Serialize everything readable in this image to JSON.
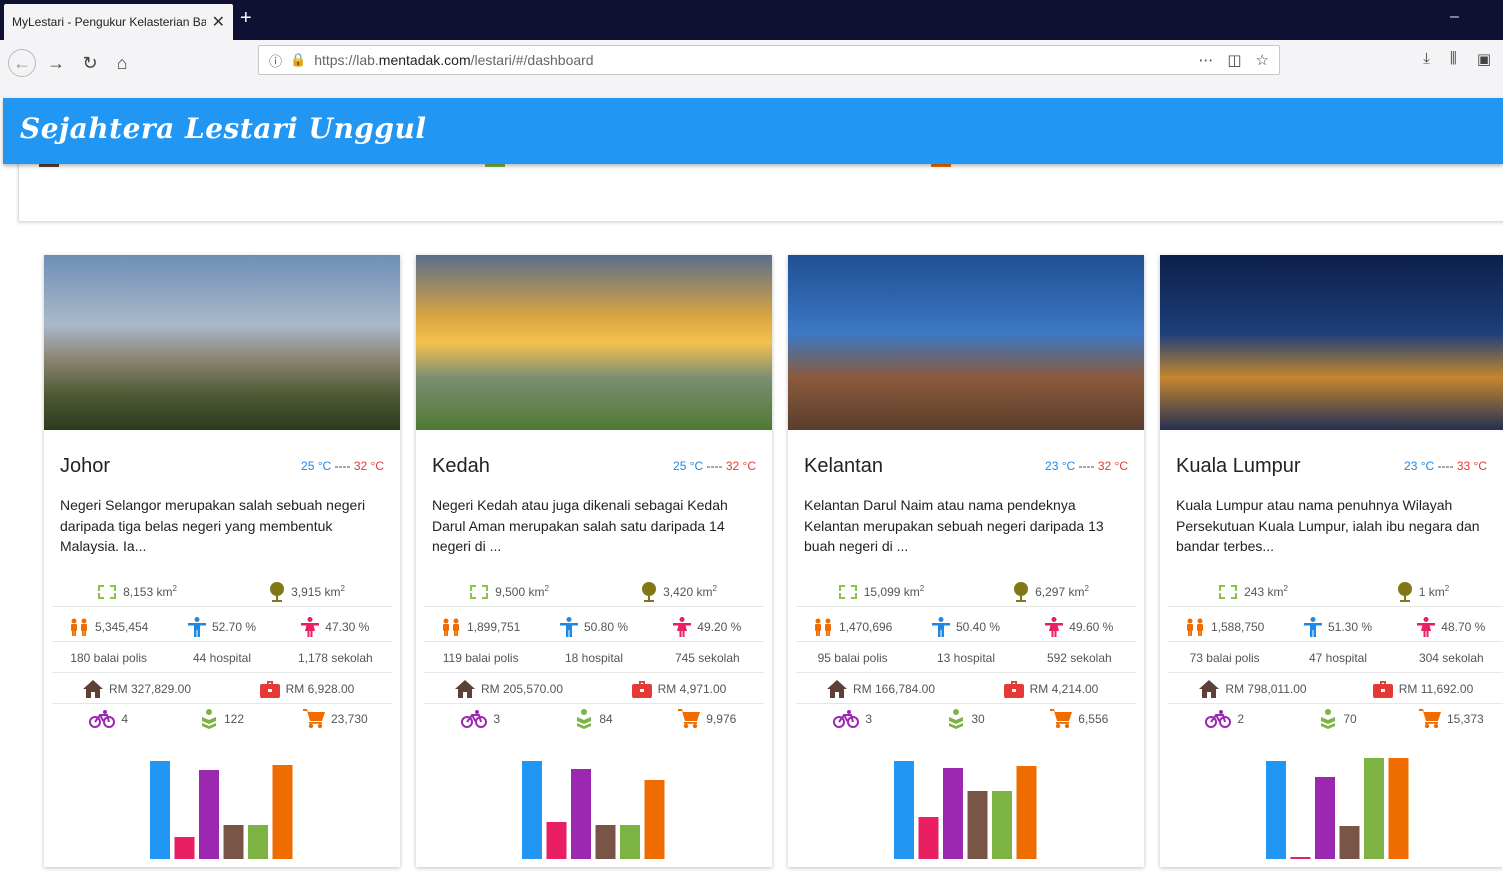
{
  "browser": {
    "tab_title": "MyLestari - Pengukur Kelasterian Ba",
    "url_prefix": "https://lab.",
    "url_domain": "mentadak.com",
    "url_path": "/lestari/#/dashboard"
  },
  "app": {
    "title": "Sejahtera Lestari Unggul"
  },
  "colors": {
    "header": "#2196f3",
    "bar_colors": [
      "#2196f3",
      "#e91e63",
      "#9c27b0",
      "#795548",
      "#7cb342",
      "#ef6c00"
    ]
  },
  "states": [
    {
      "name": "Johor",
      "temp_min": "25 °C",
      "temp_sep": "----",
      "temp_max": "32 °C",
      "desc": "Negeri Selangor merupakan salah sebuah negeri daripada tiga belas negeri yang membentuk Malaysia. Ia...",
      "area": "8,153 km",
      "forest": "3,915 km",
      "population": "5,345,454",
      "male": "52.70 %",
      "female": "47.30 %",
      "police": "180 balai polis",
      "hospital": "44 hospital",
      "school": "1,178 sekolah",
      "house": "RM 327,829.00",
      "income": "RM 6,928.00",
      "bike": "4",
      "park": "122",
      "shop": "23,730",
      "bars": [
        98,
        22,
        89,
        34,
        34,
        94
      ]
    },
    {
      "name": "Kedah",
      "temp_min": "25 °C",
      "temp_sep": "----",
      "temp_max": "32 °C",
      "desc": "Negeri Kedah atau juga dikenali sebagai Kedah Darul Aman merupakan salah satu daripada 14 negeri di ...",
      "area": "9,500 km",
      "forest": "3,420 km",
      "population": "1,899,751",
      "male": "50.80 %",
      "female": "49.20 %",
      "police": "119 balai polis",
      "hospital": "18 hospital",
      "school": "745 sekolah",
      "house": "RM 205,570.00",
      "income": "RM 4,971.00",
      "bike": "3",
      "park": "84",
      "shop": "9,976",
      "bars": [
        98,
        37,
        90,
        34,
        34,
        79
      ]
    },
    {
      "name": "Kelantan",
      "temp_min": "23 °C",
      "temp_sep": "----",
      "temp_max": "32 °C",
      "desc": "Kelantan Darul Naim atau nama pendeknya Kelantan merupakan sebuah negeri daripada 13 buah negeri di ...",
      "area": "15,099 km",
      "forest": "6,297 km",
      "population": "1,470,696",
      "male": "50.40 %",
      "female": "49.60 %",
      "police": "95 balai polis",
      "hospital": "13 hospital",
      "school": "592 sekolah",
      "house": "RM 166,784.00",
      "income": "RM 4,214.00",
      "bike": "3",
      "park": "30",
      "shop": "6,556",
      "bars": [
        98,
        42,
        91,
        68,
        68,
        93
      ]
    },
    {
      "name": "Kuala Lumpur",
      "temp_min": "23 °C",
      "temp_sep": "----",
      "temp_max": "33 °C",
      "desc": "Kuala Lumpur atau nama penuhnya Wilayah Persekutuan Kuala Lumpur, ialah ibu negara dan bandar terbes...",
      "area": "243 km",
      "forest": "1 km",
      "population": "1,588,750",
      "male": "51.30 %",
      "female": "48.70 %",
      "police": "73 balai polis",
      "hospital": "47 hospital",
      "school": "304 sekolah",
      "house": "RM 798,011.00",
      "income": "RM 11,692.00",
      "bike": "2",
      "park": "70",
      "shop": "15,373",
      "bars": [
        98,
        2,
        82,
        33,
        101,
        101
      ]
    }
  ]
}
